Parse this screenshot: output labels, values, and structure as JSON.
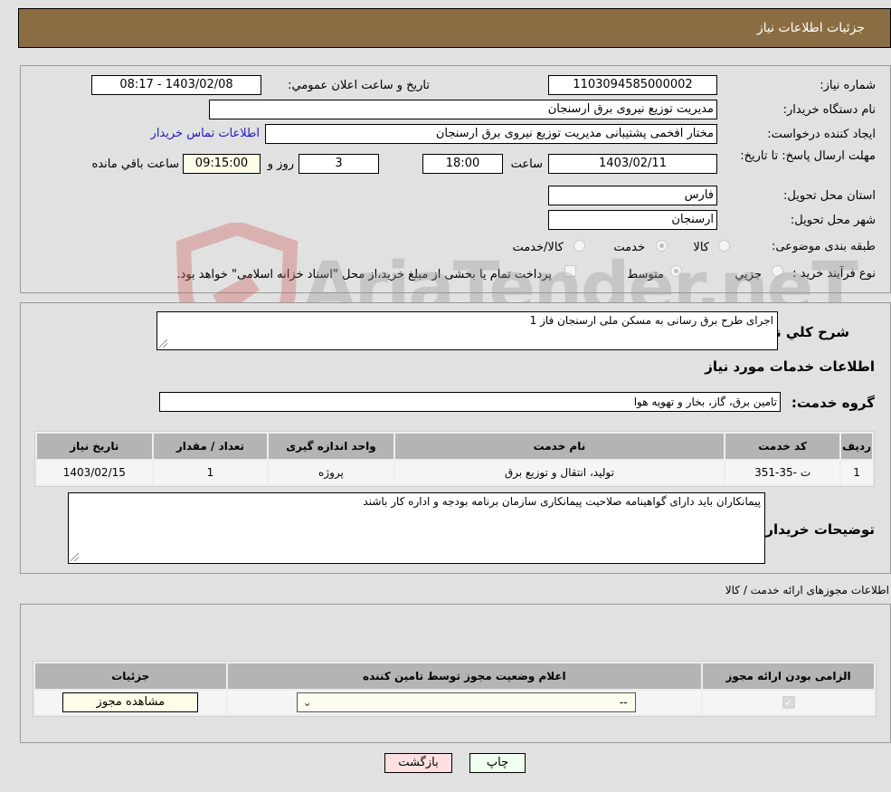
{
  "header": {
    "title": "جزئیات اطلاعات نیاز"
  },
  "details": {
    "need_number_label": "شماره نیاز:",
    "need_number": "1103094585000002",
    "announce_label": "تاریخ و ساعت اعلان عمومي:",
    "announce_value": "1403/02/08 - 08:17",
    "buyer_org_label": "نام دستگاه خریدار:",
    "buyer_org": "مدیریت توزیع نیروی برق ارسنجان",
    "creator_label": "ایجاد کننده درخواست:",
    "creator": "مختار افخمی پشتیبانی مدیریت توزیع نیروی برق ارسنجان",
    "contact_link": "اطلاعات تماس خریدار",
    "deadline_label": "مهلت ارسال پاسخ: تا تاریخ:",
    "deadline_date": "1403/02/11",
    "time_label": "ساعت",
    "deadline_time": "18:00",
    "days_value": "3",
    "days_label": "روز و",
    "remaining_time": "09:15:00",
    "remaining_label": "ساعت باقي مانده",
    "province_label": "استان محل تحویل:",
    "province": "فارس",
    "city_label": "شهر محل تحویل:",
    "city": "ارسنجان",
    "category_label": "طبقه بندی موضوعی:",
    "category_options": [
      "کالا",
      "خدمت",
      "کالا/خدمت"
    ],
    "category_selected": "خدمت",
    "purchase_type_label": "نوع فرآیند خرید :",
    "purchase_options": [
      "جزیي",
      "متوسط"
    ],
    "purchase_selected": "متوسط",
    "treasury_note": "پرداخت تمام یا بخشی از مبلغ خرید،از محل \"اسناد خزانه اسلامی\" خواهد بود."
  },
  "watermark": "AriaTender.neT",
  "need": {
    "description_label": "شرح کلي نیاز:",
    "description": "اجرای طرح برق رسانی به مسکن ملی ارسنجان فاز 1",
    "services_title": "اطلاعات خدمات مورد نیاز",
    "service_group_label": "گروه خدمت:",
    "service_group": "تامین برق، گاز، بخار و تهویه هوا",
    "table": {
      "headers": [
        "ردیف",
        "کد خدمت",
        "نام خدمت",
        "واحد اندازه گیری",
        "تعداد / مقدار",
        "تاریخ نیاز"
      ],
      "rows": [
        [
          "1",
          "ت -35-351",
          "تولید، انتقال و توزیع برق",
          "پروژه",
          "1",
          "1403/02/15"
        ]
      ]
    },
    "buyer_notes_label": "توضیحات خریدار:",
    "buyer_notes": "پیمانکاران باید دارای گواهینامه صلاحیت پیمانکاری سازمان برنامه بودجه و اداره کار باشند"
  },
  "permits": {
    "title": "اطلاعات مجوزهای ارائه خدمت / کالا",
    "headers": [
      "الزامی بودن ارائه مجوز",
      "اعلام وضعیت مجوز توسط تامین کننده",
      "جزئیات"
    ],
    "row": {
      "required_checked": true,
      "status_value": "--",
      "view_button": "مشاهده مجوز"
    }
  },
  "footer": {
    "print_button": "چاپ",
    "back_button": "بازگشت"
  }
}
